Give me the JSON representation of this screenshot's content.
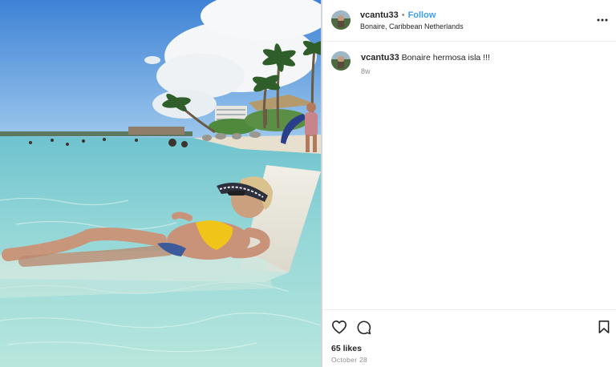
{
  "post": {
    "author": {
      "username": "vcantu33",
      "follow_label": "Follow",
      "separator": "•",
      "location": "Bonaire, Caribbean Netherlands"
    },
    "caption": {
      "username": "vcantu33",
      "text": "Bonaire hermosa isla !!!",
      "age": "8w"
    },
    "engagement": {
      "likes": "65 likes",
      "date": "October 28"
    }
  },
  "icons": {
    "more": "more-horizontal-icon",
    "like": "heart-icon",
    "comment": "comment-icon",
    "save": "bookmark-icon"
  },
  "colors": {
    "follow_accent": "#3b9ef0",
    "secondary_text": "#8e8e8e",
    "primary_text": "#262626"
  }
}
